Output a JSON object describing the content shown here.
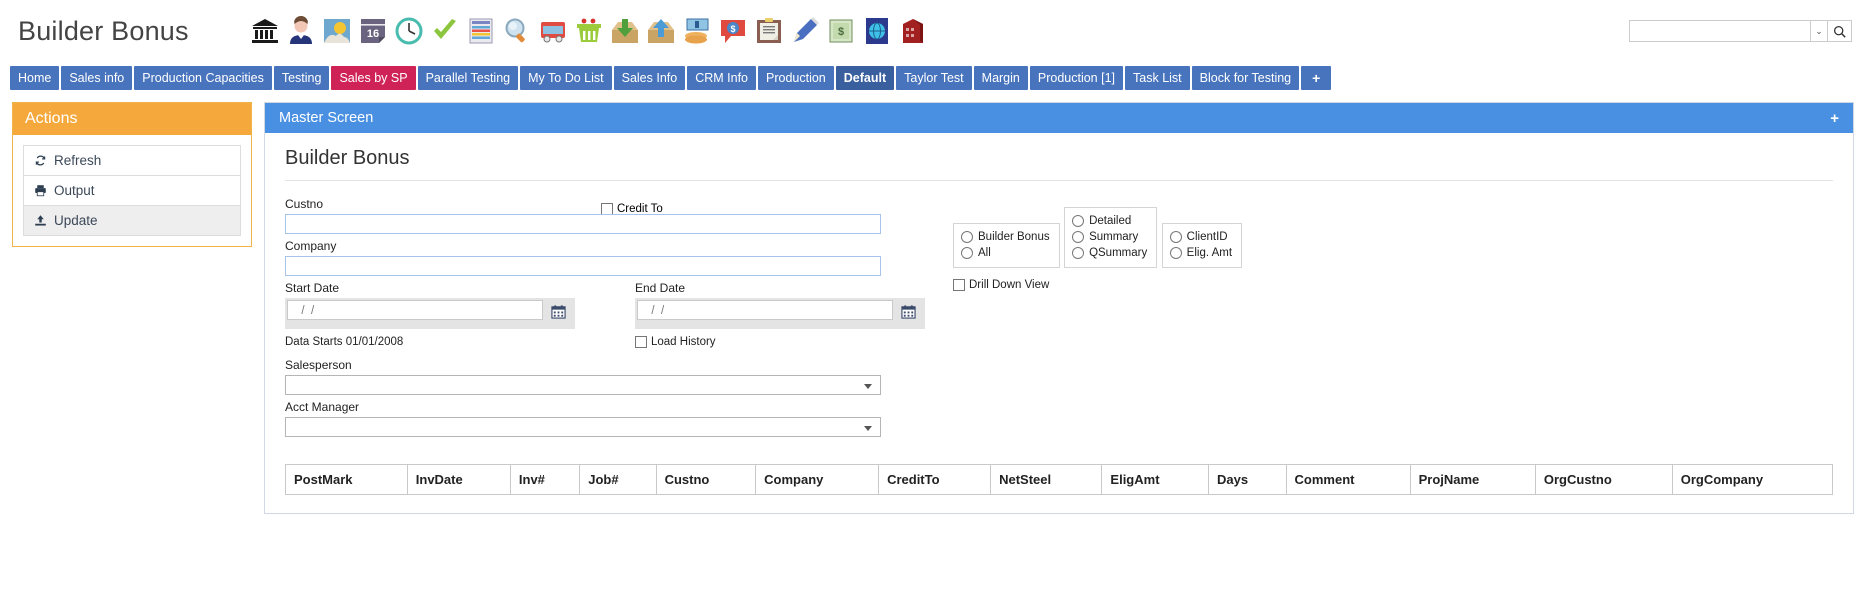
{
  "header": {
    "app_title": "Builder Bonus",
    "search_value": "",
    "search_placeholder": "",
    "dropdown_caret": "⌄",
    "icons": [
      {
        "name": "bank-icon",
        "label": "Bank"
      },
      {
        "name": "user-icon",
        "label": "User"
      },
      {
        "name": "weather-icon",
        "label": "Weather"
      },
      {
        "name": "calendar-16-icon",
        "label": "16"
      },
      {
        "name": "clock-icon",
        "label": "Clock"
      },
      {
        "name": "checkmark-icon",
        "label": "Check"
      },
      {
        "name": "spreadsheet-icon",
        "label": "Spreadsheet"
      },
      {
        "name": "magnifier-icon",
        "label": "Search"
      },
      {
        "name": "truck-icon",
        "label": "Truck"
      },
      {
        "name": "basket-icon",
        "label": "Basket"
      },
      {
        "name": "inbox-down-icon",
        "label": "Import"
      },
      {
        "name": "inbox-up-icon",
        "label": "Export"
      },
      {
        "name": "money-hand-icon",
        "label": "Payment"
      },
      {
        "name": "dollar-bubble-icon",
        "label": "Quote"
      },
      {
        "name": "clipboard-icon",
        "label": "Clipboard"
      },
      {
        "name": "pencil-icon",
        "label": "Edit"
      },
      {
        "name": "cash-icon",
        "label": "Cash"
      },
      {
        "name": "globe-icon",
        "label": "Web"
      },
      {
        "name": "building-icon",
        "label": "Building"
      }
    ]
  },
  "tabs": [
    {
      "label": "Home",
      "state": "normal"
    },
    {
      "label": "Sales info",
      "state": "normal"
    },
    {
      "label": "Production Capacities",
      "state": "normal"
    },
    {
      "label": "Testing",
      "state": "normal"
    },
    {
      "label": "Sales by SP",
      "state": "pink"
    },
    {
      "label": "Parallel Testing",
      "state": "normal"
    },
    {
      "label": "My To Do List",
      "state": "normal"
    },
    {
      "label": "Sales Info",
      "state": "normal"
    },
    {
      "label": "CRM Info",
      "state": "normal"
    },
    {
      "label": "Production",
      "state": "normal"
    },
    {
      "label": "Default",
      "state": "dark"
    },
    {
      "label": "Taylor Test",
      "state": "normal"
    },
    {
      "label": "Margin",
      "state": "normal"
    },
    {
      "label": "Production [1]",
      "state": "normal"
    },
    {
      "label": "Task List",
      "state": "normal"
    },
    {
      "label": "Block for Testing",
      "state": "normal"
    }
  ],
  "tab_add_label": "+",
  "actions": {
    "title": "Actions",
    "items": [
      {
        "label": "Refresh",
        "icon": "refresh-icon"
      },
      {
        "label": "Output",
        "icon": "printer-icon"
      },
      {
        "label": "Update",
        "icon": "upload-icon"
      }
    ]
  },
  "master": {
    "title": "Master Screen",
    "collapse_label": "+",
    "page_title": "Builder Bonus"
  },
  "form": {
    "custno_label": "Custno",
    "custno_value": "",
    "credit_to_label": "Credit To",
    "company_label": "Company",
    "company_value": "",
    "start_date_label": "Start Date",
    "start_date_value": "  /  /",
    "end_date_label": "End Date",
    "end_date_value": "  /  /",
    "data_starts_hint": "Data Starts 01/01/2008",
    "load_history_label": "Load History",
    "salesperson_label": "Salesperson",
    "salesperson_value": "",
    "acct_manager_label": "Acct Manager",
    "acct_manager_value": "",
    "group_scope": [
      {
        "label": "Builder Bonus",
        "selected": false
      },
      {
        "label": "All",
        "selected": false
      }
    ],
    "group_detail": [
      {
        "label": "Detailed",
        "selected": false
      },
      {
        "label": "Summary",
        "selected": false
      },
      {
        "label": "QSummary",
        "selected": false
      }
    ],
    "group_id": [
      {
        "label": "ClientID",
        "selected": false
      },
      {
        "label": "Elig. Amt",
        "selected": false
      }
    ],
    "drill_down_label": "Drill Down View"
  },
  "results": {
    "columns": [
      "PostMark",
      "InvDate",
      "Inv#",
      "Job#",
      "Custno",
      "Company",
      "CreditTo",
      "NetSteel",
      "EligAmt",
      "Days",
      "Comment",
      "ProjName",
      "OrgCustno",
      "OrgCompany"
    ],
    "rows": []
  },
  "colors": {
    "tab_blue": "#4874bd",
    "tab_pink": "#cf2358",
    "tab_active": "#3a5f9f",
    "actions_orange": "#f5a93c",
    "master_blue": "#4a90e2"
  }
}
